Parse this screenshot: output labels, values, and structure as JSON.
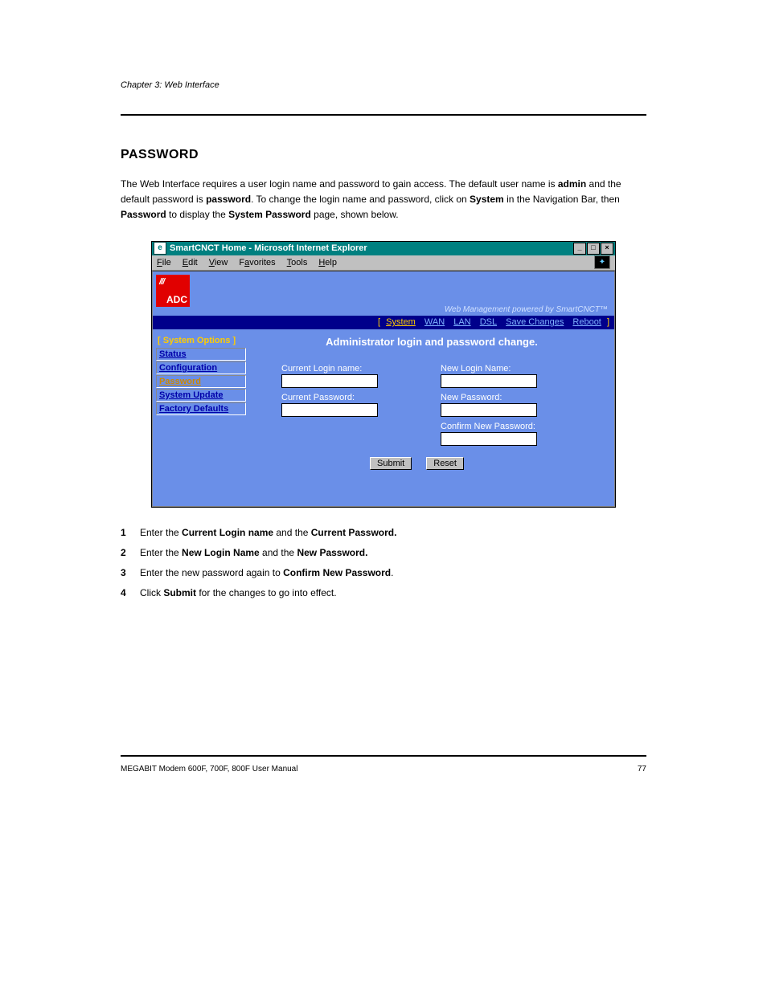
{
  "doc": {
    "chapter_line": "Chapter 3: Web Interface",
    "section_title": "PASSWORD",
    "intro_1a": "The Web Interface requires a user login name and password to gain access. The default user name is ",
    "intro_1_admin": "admin",
    "intro_1b": " and the default password is ",
    "intro_1_password": "password",
    "intro_1c": ". To change the login name and password, click on ",
    "intro_1_system": "System",
    "intro_1d": " in the Navigation Bar, then ",
    "intro_1_passlink": "Password",
    "intro_1e": " to display the ",
    "intro_1_syspass": "System Password",
    "intro_1f": " page, shown below.",
    "step1a": "Enter the ",
    "step1_cur_login": "Current Login name",
    "step1b": " and the ",
    "step1_cur_pass": "Current Password.",
    "step2a": "Enter the ",
    "step2_new_login": "New Login Name",
    "step2b": " and the ",
    "step2_new_pass": "New Password.",
    "step3a": "Enter the new password again to ",
    "step3_confirm": "Confirm New Password",
    "step3b": ".",
    "step4a": "Click ",
    "step4_submit": "Submit",
    "step4b": " for the changes to go into effect.",
    "footer_left": "MEGABIT Modem 600F, 700F, 800F User Manual",
    "footer_right": "77"
  },
  "win": {
    "title": "SmartCNCT Home - Microsoft Internet Explorer",
    "menu": {
      "file": "File",
      "edit": "Edit",
      "view": "View",
      "favorites": "Favorites",
      "tools": "Tools",
      "help": "Help"
    },
    "tagline": "Web Management powered by SmartCNCT™",
    "nav": {
      "system": "System",
      "wan": "WAN",
      "lan": "LAN",
      "dsl": "DSL",
      "save": "Save Changes",
      "reboot": "Reboot"
    },
    "sidebar": {
      "head": "System Options",
      "status": "Status",
      "config": "Configuration",
      "password": "Password",
      "update": "System Update",
      "factory": "Factory Defaults"
    },
    "form": {
      "title": "Administrator login and password change.",
      "cur_login": "Current Login name:",
      "new_login": "New Login Name:",
      "cur_pass": "Current Password:",
      "new_pass": "New Password:",
      "confirm": "Confirm New Password:",
      "submit": "Submit",
      "reset": "Reset"
    },
    "logo": "ADC"
  }
}
